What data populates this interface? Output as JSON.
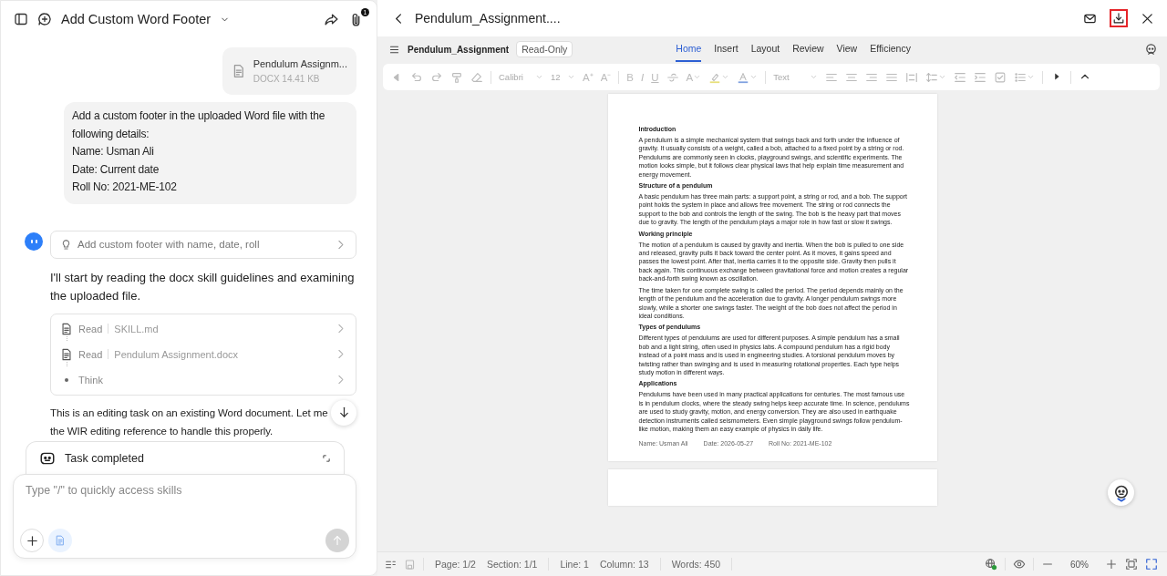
{
  "chat": {
    "title": "Add Custom Word Footer",
    "attachment_count": "1",
    "attachment": {
      "name": "Pendulum Assignm...",
      "meta": "DOCX 14.41 KB"
    },
    "user_message": [
      "Add a custom footer in the uploaded Word file with the following details:",
      "Name: Usman Ali",
      "Date: Current date",
      "Roll No: 2021-ME-102"
    ],
    "suggestion": "Add custom footer with name, date, roll",
    "reply": "I'll start by reading the docx skill guidelines and examining the uploaded file.",
    "steps": [
      {
        "kind": "file",
        "action": "Read",
        "target": "SKILL.md"
      },
      {
        "kind": "file",
        "action": "Read",
        "target": "Pendulum Assignment.docx"
      },
      {
        "kind": "dot",
        "action": "Think"
      }
    ],
    "reply2": [
      "This is an editing task on an existing Word document. Let me",
      "the WIR editing reference to handle this properly."
    ],
    "task_status": "Task completed",
    "composer": {
      "placeholder": "Type \"/\" to quickly access skills"
    }
  },
  "viewer": {
    "title": "Pendulum_Assignment....",
    "file_name": "Pendulum_Assignment",
    "badge": "Read-Only",
    "tabs": [
      {
        "label": "Home",
        "selected": true
      },
      {
        "label": "Insert",
        "selected": false
      },
      {
        "label": "Layout",
        "selected": false
      },
      {
        "label": "Review",
        "selected": false
      },
      {
        "label": "View",
        "selected": false
      },
      {
        "label": "Efficiency",
        "selected": false
      }
    ],
    "toolbar": {
      "font": "Calibri",
      "size": "12",
      "style": "Text",
      "glyphs": [
        "A⁺",
        "A⁻",
        "B",
        "I",
        "U",
        "A"
      ]
    },
    "document": {
      "blocks": [
        {
          "kind": "heading",
          "text": "Introduction"
        },
        {
          "kind": "para",
          "text": "A pendulum is a simple mechanical system that swings back and forth under the influence of gravity. It usually consists of a weight, called a bob, attached to a fixed point by a string or rod. Pendulums are commonly seen in clocks, playground swings, and scientific experiments. The motion looks simple, but it follows clear physical laws that help explain time measurement and energy movement."
        },
        {
          "kind": "heading",
          "text": "Structure of a pendulum"
        },
        {
          "kind": "para",
          "text": "A basic pendulum has three main parts: a support point, a string or rod, and a bob. The support point holds the system in place and allows free movement. The string or rod connects the support to the bob and controls the length of the swing. The bob is the heavy part that moves due to gravity. The length of the pendulum plays a major role in how fast or slow it swings."
        },
        {
          "kind": "heading",
          "text": "Working principle"
        },
        {
          "kind": "para",
          "text": "The motion of a pendulum is caused by gravity and inertia. When the bob is pulled to one side and released, gravity pulls it back toward the center point. As it moves, it gains speed and passes the lowest point. After that, inertia carries it to the opposite side. Gravity then pulls it back again. This continuous exchange between gravitational force and motion creates a regular back-and-forth swing known as oscillation."
        },
        {
          "kind": "para",
          "text": "The time taken for one complete swing is called the period. The period depends mainly on the length of the pendulum and the acceleration due to gravity. A longer pendulum swings more slowly, while a shorter one swings faster. The weight of the bob does not affect the period in ideal conditions."
        },
        {
          "kind": "heading",
          "text": "Types of pendulums"
        },
        {
          "kind": "para",
          "text": "Different types of pendulums are used for different purposes. A simple pendulum has a small bob and a light string, often used in physics labs. A compound pendulum has a rigid body instead of a point mass and is used in engineering studies. A torsional pendulum moves by twisting rather than swinging and is used in measuring rotational properties. Each type helps study motion in different ways."
        },
        {
          "kind": "heading",
          "text": "Applications"
        },
        {
          "kind": "para",
          "text": "Pendulums have been used in many practical applications for centuries. The most famous use is in pendulum clocks, where the steady swing helps keep accurate time. In science, pendulums are used to study gravity, motion, and energy conversion. They are also used in earthquake detection instruments called seismometers. Even simple playground swings follow pendulum-like motion, making them an easy example of physics in daily life."
        }
      ],
      "footer": [
        "Name: Usman Ali",
        "Date: 2026-05-27",
        "Roll No: 2021-ME-102"
      ]
    },
    "status": [
      [
        "Page: 1/2",
        "Section: 1/1"
      ],
      [
        "Line: 1",
        "Column: 13"
      ],
      [
        "Words: 450"
      ]
    ],
    "zoom": "60%"
  }
}
